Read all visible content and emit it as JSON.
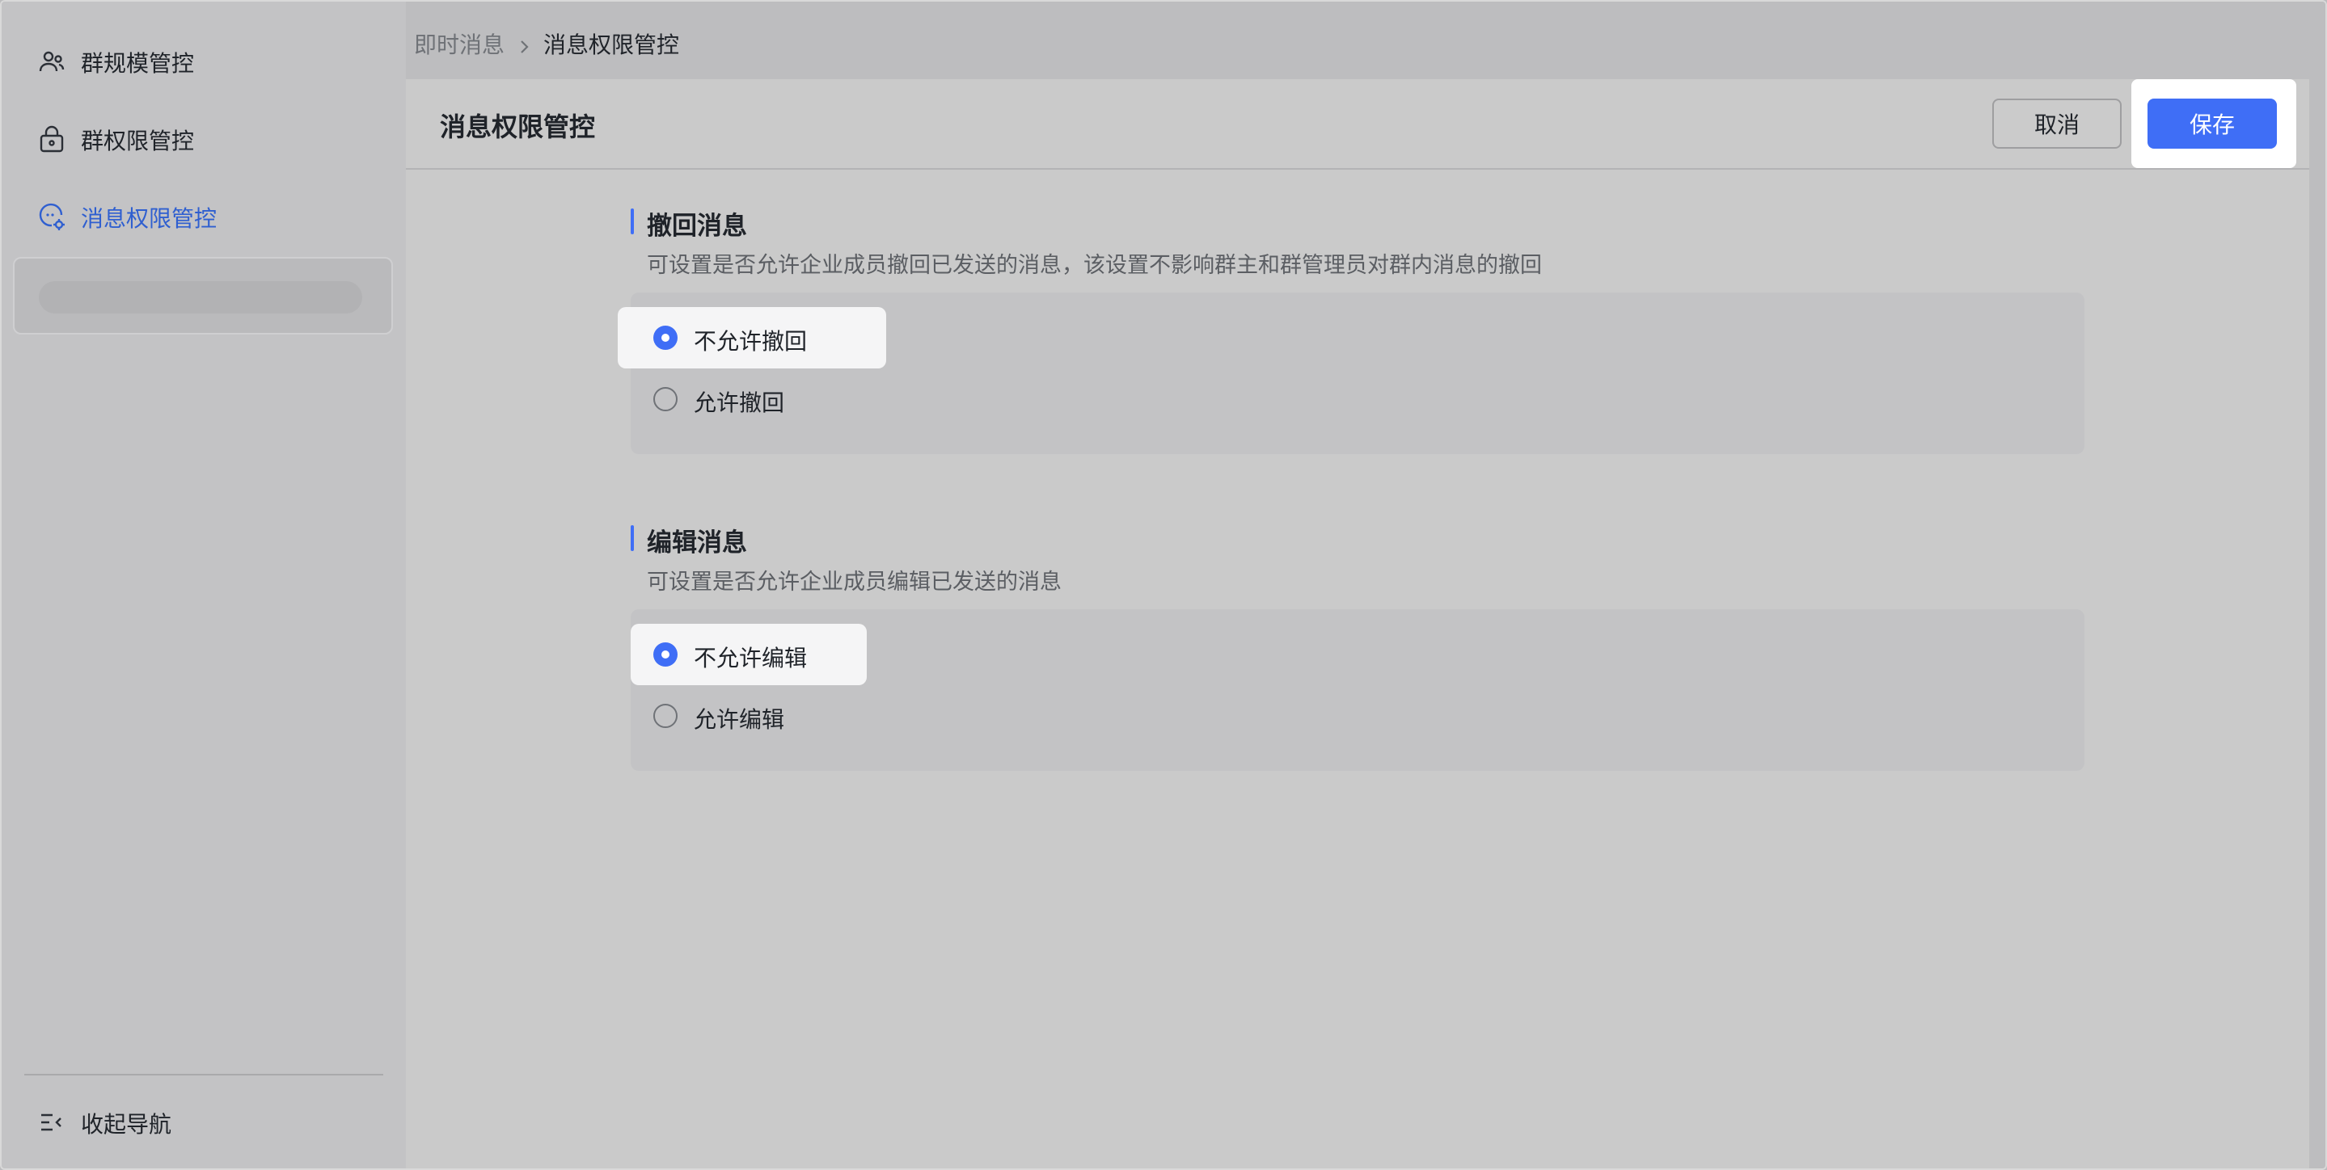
{
  "sidebar": {
    "items": [
      {
        "label": "群规模管控",
        "icon": "group-users-icon"
      },
      {
        "label": "群权限管控",
        "icon": "lock-icon"
      },
      {
        "label": "消息权限管控",
        "icon": "message-settings-icon",
        "active": true
      }
    ],
    "collapse_label": "收起导航"
  },
  "breadcrumb": {
    "parent": "即时消息",
    "current": "消息权限管控"
  },
  "panel": {
    "title": "消息权限管控",
    "cancel_label": "取消",
    "save_label": "保存"
  },
  "sections": [
    {
      "title": "撤回消息",
      "description": "可设置是否允许企业成员撤回已发送的消息，该设置不影响群主和群管理员对群内消息的撤回",
      "options": [
        {
          "label": "不允许撤回",
          "selected": true
        },
        {
          "label": "允许撤回",
          "selected": false
        }
      ]
    },
    {
      "title": "编辑消息",
      "description": "可设置是否允许企业成员编辑已发送的消息",
      "options": [
        {
          "label": "不允许编辑",
          "selected": true
        },
        {
          "label": "允许编辑",
          "selected": false
        }
      ]
    }
  ],
  "colors": {
    "accent": "#3f6ef6",
    "active_nav": "#2f5fd0"
  }
}
